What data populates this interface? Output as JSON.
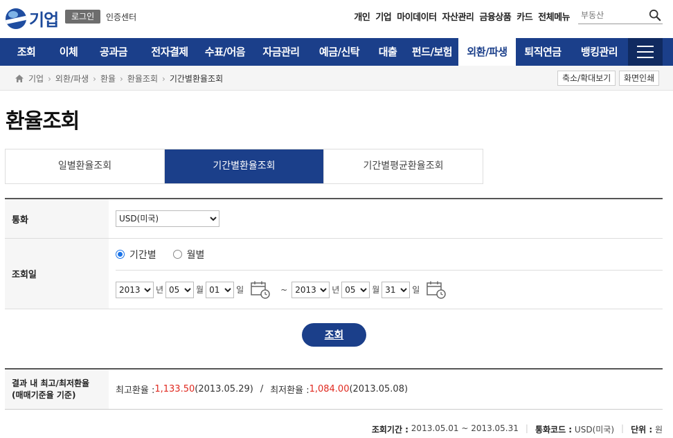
{
  "header": {
    "logo_text": "기업",
    "login_label": "로그인",
    "cert_label": "인증센터",
    "util_nav": [
      "개인",
      "기업",
      "마이데이터",
      "자산관리",
      "금융상품",
      "카드",
      "전체메뉴"
    ],
    "search_placeholder": "부동산"
  },
  "mainnav": {
    "items": [
      "조회",
      "이체",
      "공과금",
      "전자결제",
      "수표/어음",
      "자금관리",
      "예금/신탁",
      "대출",
      "펀드/보험",
      "외환/파생",
      "퇴직연금",
      "뱅킹관리"
    ],
    "active": "외환/파생"
  },
  "breadcrumb": {
    "items": [
      "기업",
      "외환/파생",
      "환율",
      "환율조회",
      "기간별환율조회"
    ]
  },
  "tools": {
    "zoom_label": "축소/확대보기",
    "print_label": "화면인쇄"
  },
  "page": {
    "title": "환율조회"
  },
  "tabs": [
    {
      "label": "일별환율조회",
      "active": false
    },
    {
      "label": "기간별환율조회",
      "active": true
    },
    {
      "label": "기간별평균환율조회",
      "active": false
    }
  ],
  "form": {
    "currency_label": "통화",
    "currency_value": "USD(미국)",
    "date_label": "조회일",
    "radio_period": "기간별",
    "radio_monthly": "월별",
    "start": {
      "year": "2013",
      "month": "05",
      "day": "01"
    },
    "end": {
      "year": "2013",
      "month": "05",
      "day": "31"
    },
    "unit_year": "년",
    "unit_month": "월",
    "unit_day": "일",
    "tilde": "~"
  },
  "query_button": "조회",
  "result": {
    "label_line1": "결과 내 최고/최저환율",
    "label_line2": "(매매기준율 기준)",
    "high_label": "최고환율 : ",
    "high_value": "1,133.50",
    "high_date": "(2013.05.29)",
    "slash": "/",
    "low_label": "최저환율 : ",
    "low_value": "1,084.00",
    "low_date": "(2013.05.08)"
  },
  "footer": {
    "period_label": "조회기간 :",
    "period_value": "2013.05.01 ~ 2013.05.31",
    "code_label": "통화코드 :",
    "code_value": "USD(미국)",
    "unit_label": "단위 :",
    "unit_value": "원"
  },
  "colors": {
    "brand": "#1b3f8a",
    "highlight": "#e0281e"
  }
}
